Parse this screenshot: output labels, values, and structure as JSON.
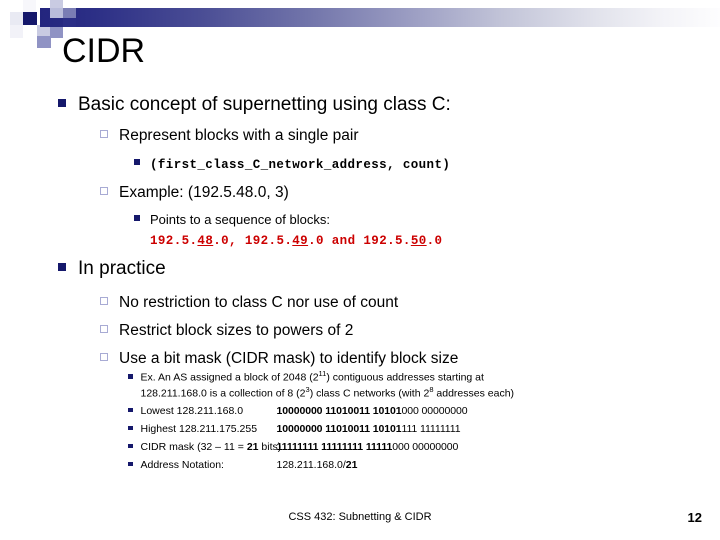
{
  "slide": {
    "title": "CIDR",
    "footer_text": "CSS 432: Subnetting & CIDR",
    "page_number": "12",
    "accent_navy": "#15186b",
    "accent_light": "#a8abd4",
    "code_red": "#cc0000"
  },
  "section_a": {
    "heading": "Basic concept of supernetting using class C:",
    "item1": "Represent blocks with a single pair",
    "item1_code": "(first_class_C_network_address, count)",
    "item2": "Example: (192.5.48.0, 3)",
    "item2_sub": "Points to a sequence of blocks:",
    "item2_code": {
      "part1_pre": "192.5.",
      "part1_u": "48",
      "part1_post": ".0,  ",
      "part2_pre": "192.5.",
      "part2_u": "49",
      "part2_post": ".0 and ",
      "part3_pre": "192.5.",
      "part3_u": "50",
      "part3_post": ".0"
    }
  },
  "section_b": {
    "heading": "In practice",
    "items": [
      "No restriction to class C nor use of count",
      "Restrict block sizes to powers of 2",
      "Use a bit mask (CIDR mask) to identify block size"
    ],
    "details": {
      "ex_line1_a": "Ex. An AS assigned a block of 2048 (2",
      "ex_line1_sup": "11",
      "ex_line1_b": ") contiguous addresses starting at",
      "ex_line2_a": "128.211.168.0 is a collection of 8 (2",
      "ex_line2_sup1": "3",
      "ex_line2_b": ") class C networks (with 2",
      "ex_line2_sup2": "8",
      "ex_line2_c": " addresses each)",
      "lowest_label": "Lowest  128.211.168.0",
      "lowest_bits_bold": "10000000 11010011 10101",
      "lowest_bits_light": "000 00000000",
      "highest_label": "Highest  128.211.175.255",
      "highest_bits_bold": "10000000 11010011 10101",
      "highest_bits_light": "111 11111111",
      "mask_label_a": "CIDR mask (32 – 11 = ",
      "mask_label_bold": "21",
      "mask_label_b": " bits)",
      "mask_bits_bold": "11111111 11111111 11111",
      "mask_bits_light": "000 00000000",
      "notation_label": "Address Notation:",
      "notation_value_a": "128.211.168.0/",
      "notation_value_bold": "21"
    }
  }
}
